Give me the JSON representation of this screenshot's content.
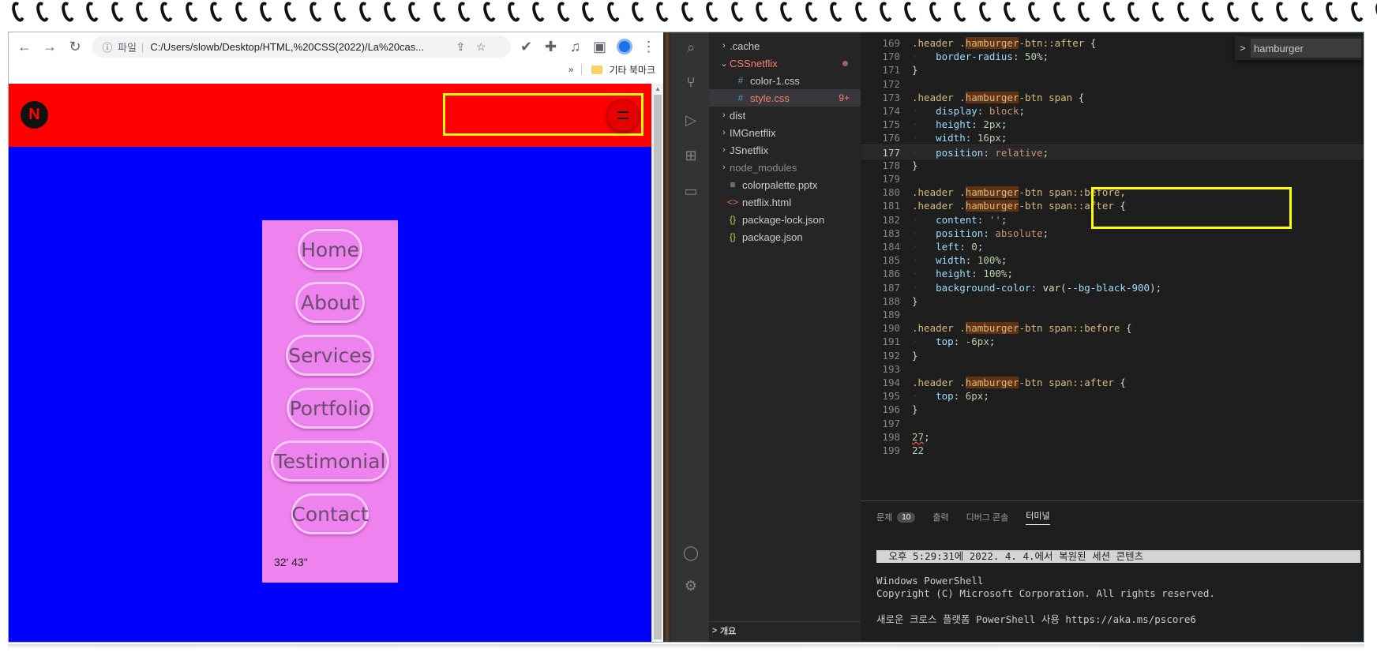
{
  "browser": {
    "address_scheme": "파일",
    "address_url": "C:/Users/slowb/Desktop/HTML,%20CSS(2022)/La%20cas...",
    "bookmarks_overflow": "»",
    "bookmarks_folder": "기타 북마크"
  },
  "site": {
    "logo_letter": "N",
    "menu_items": [
      "Home",
      "About",
      "Services",
      "Portfolio",
      "Testimonial",
      "Contact"
    ],
    "coords_text": "32' 43\"",
    "colors": {
      "header": "#ff0000",
      "body": "#0000ff",
      "menu": "#ee82ee",
      "highlight": "#ffff00"
    }
  },
  "explorer": {
    "items": [
      {
        "chevron": ">",
        "icon": "",
        "label": ".cache",
        "color": "#cccccc"
      },
      {
        "chevron": "v",
        "icon": "",
        "label": "CSSnetflix",
        "color": "#f88070",
        "dot": true
      },
      {
        "chevron": "",
        "icon": "#",
        "label": "color-1.css",
        "color": "#cccccc"
      },
      {
        "chevron": "",
        "icon": "#",
        "label": "style.css",
        "color": "#f88070",
        "badge": "9+"
      },
      {
        "chevron": ">",
        "icon": "",
        "label": "dist",
        "color": "#cccccc"
      },
      {
        "chevron": ">",
        "icon": "",
        "label": "IMGnetflix",
        "color": "#cccccc"
      },
      {
        "chevron": ">",
        "icon": "",
        "label": "JSnetflix",
        "color": "#cccccc"
      },
      {
        "chevron": ">",
        "icon": "",
        "label": "node_modules",
        "color": "#8c8c8c"
      },
      {
        "chevron": "",
        "icon": "≡",
        "label": "colorpalette.pptx",
        "color": "#cccccc"
      },
      {
        "chevron": "",
        "icon": "<>",
        "label": "netflix.html",
        "color": "#cccccc"
      },
      {
        "chevron": "",
        "icon": "{}",
        "label": "package-lock.json",
        "color": "#cccccc"
      },
      {
        "chevron": "",
        "icon": "{}",
        "label": "package.json",
        "color": "#cccccc"
      }
    ],
    "outline_label": "개요"
  },
  "editor": {
    "find_query": "hamburger",
    "current_line": "177",
    "lines": [
      {
        "n": "169",
        "code": ".header .hamburger-btn::after {"
      },
      {
        "n": "170",
        "code": "    border-radius: 50%;"
      },
      {
        "n": "171",
        "code": "}"
      },
      {
        "n": "172",
        "code": ""
      },
      {
        "n": "173",
        "code": ".header .hamburger-btn span {"
      },
      {
        "n": "174",
        "code": "    display: block;"
      },
      {
        "n": "175",
        "code": "    height: 2px;"
      },
      {
        "n": "176",
        "code": "    width: 16px;"
      },
      {
        "n": "177",
        "code": "    position: relative;"
      },
      {
        "n": "178",
        "code": "}"
      },
      {
        "n": "179",
        "code": ""
      },
      {
        "n": "180",
        "code": ".header .hamburger-btn span::before,"
      },
      {
        "n": "181",
        "code": ".header .hamburger-btn span::after {"
      },
      {
        "n": "182",
        "code": "    content: '';"
      },
      {
        "n": "183",
        "code": "    position: absolute;"
      },
      {
        "n": "184",
        "code": "    left: 0;"
      },
      {
        "n": "185",
        "code": "    width: 100%;"
      },
      {
        "n": "186",
        "code": "    height: 100%;"
      },
      {
        "n": "187",
        "code": "    background-color: var(--bg-black-900);"
      },
      {
        "n": "188",
        "code": "}"
      },
      {
        "n": "189",
        "code": ""
      },
      {
        "n": "190",
        "code": ".header .hamburger-btn span::before {"
      },
      {
        "n": "191",
        "code": "    top: -6px;"
      },
      {
        "n": "192",
        "code": "}"
      },
      {
        "n": "193",
        "code": ""
      },
      {
        "n": "194",
        "code": ".header .hamburger-btn span::after {"
      },
      {
        "n": "195",
        "code": "    top: 6px;"
      },
      {
        "n": "196",
        "code": "}"
      },
      {
        "n": "197",
        "code": ""
      },
      {
        "n": "198",
        "code": "27;"
      },
      {
        "n": "199",
        "code": "22"
      }
    ]
  },
  "panel": {
    "tabs": [
      {
        "label": "문제",
        "badge": "10"
      },
      {
        "label": "출력",
        "badge": ""
      },
      {
        "label": "디버그 콘솔",
        "badge": ""
      },
      {
        "label": "터미널",
        "badge": "",
        "active": true
      }
    ],
    "banner": " 오후 5:29:31에 2022. 4. 4.에서 복원된 세션 콘텐츠",
    "term_lines": [
      "Windows PowerShell",
      "Copyright (C) Microsoft Corporation. All rights reserved.",
      "",
      "새로운 크로스 플랫폼 PowerShell 사용 https://aka.ms/pscore6"
    ]
  },
  "icons": [
    "back-arrow-icon",
    "forward-arrow-icon",
    "reload-icon",
    "info-icon",
    "share-icon",
    "star-icon",
    "extension-icon",
    "puzzle-icon",
    "media-icon",
    "sidepanel-icon",
    "profile-icon",
    "kebab-icon",
    "search-icon",
    "source-control-icon",
    "run-debug-icon",
    "extensions-icon",
    "remote-icon",
    "account-icon",
    "settings-icon"
  ]
}
